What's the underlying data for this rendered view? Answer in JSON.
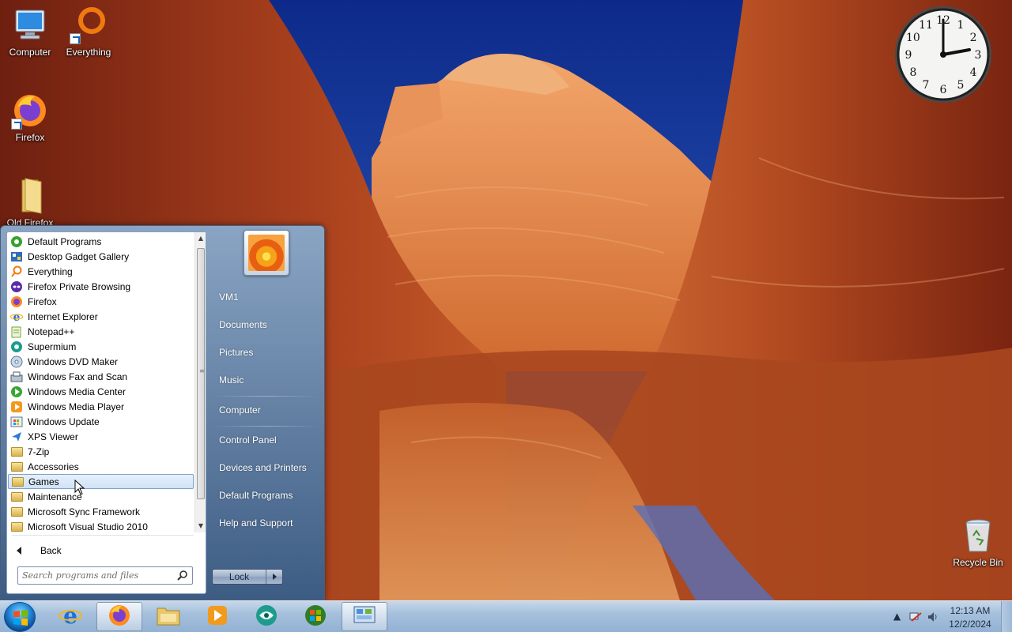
{
  "desktop": {
    "icons": [
      {
        "label": "Computer"
      },
      {
        "label": "Everything"
      },
      {
        "label": "Firefox"
      },
      {
        "label": "Old Firefox"
      },
      {
        "label": "Recycle Bin"
      }
    ]
  },
  "clock_gadget": {
    "numerals": [
      "12",
      "1",
      "2",
      "3",
      "4",
      "5",
      "6",
      "7",
      "8",
      "9",
      "10",
      "11"
    ]
  },
  "start_menu": {
    "programs": [
      {
        "label": "Default Programs",
        "icon": "default-programs-icon"
      },
      {
        "label": "Desktop Gadget Gallery",
        "icon": "gadget-gallery-icon"
      },
      {
        "label": "Everything",
        "icon": "everything-icon"
      },
      {
        "label": "Firefox Private Browsing",
        "icon": "firefox-private-icon"
      },
      {
        "label": "Firefox",
        "icon": "firefox-icon"
      },
      {
        "label": "Internet Explorer",
        "icon": "internet-explorer-icon"
      },
      {
        "label": "Notepad++",
        "icon": "notepad-plus-plus-icon"
      },
      {
        "label": "Supermium",
        "icon": "supermium-icon"
      },
      {
        "label": "Windows DVD Maker",
        "icon": "dvd-maker-icon"
      },
      {
        "label": "Windows Fax and Scan",
        "icon": "fax-scan-icon"
      },
      {
        "label": "Windows Media Center",
        "icon": "media-center-icon"
      },
      {
        "label": "Windows Media Player",
        "icon": "media-player-icon"
      },
      {
        "label": "Windows Update",
        "icon": "windows-update-icon"
      },
      {
        "label": "XPS Viewer",
        "icon": "xps-viewer-icon"
      },
      {
        "label": "7-Zip",
        "icon": "folder-icon"
      },
      {
        "label": "Accessories",
        "icon": "folder-icon"
      },
      {
        "label": "Games",
        "icon": "folder-icon",
        "selected": true
      },
      {
        "label": "Maintenance",
        "icon": "folder-icon"
      },
      {
        "label": "Microsoft Sync Framework",
        "icon": "folder-icon"
      },
      {
        "label": "Microsoft Visual Studio 2010",
        "icon": "folder-icon"
      }
    ],
    "back_label": "Back",
    "search_placeholder": "Search programs and files",
    "right_items": {
      "user": "VM1",
      "documents": "Documents",
      "pictures": "Pictures",
      "music": "Music",
      "computer": "Computer",
      "control_panel": "Control Panel",
      "devices_printers": "Devices and Printers",
      "default_programs": "Default Programs",
      "help_support": "Help and Support"
    },
    "lock_label": "Lock"
  },
  "taskbar": {
    "pinned": [
      {
        "name": "internet-explorer-taskbar-button",
        "icon": "internet-explorer-icon"
      },
      {
        "name": "firefox-taskbar-button",
        "icon": "firefox-icon",
        "active": true
      },
      {
        "name": "explorer-taskbar-button",
        "icon": "folder-icon"
      },
      {
        "name": "media-player-taskbar-button",
        "icon": "media-player-icon"
      },
      {
        "name": "supermium-taskbar-button",
        "icon": "supermium-icon"
      },
      {
        "name": "windows-update-taskbar-button",
        "icon": "windows-orb-icon"
      },
      {
        "name": "control-panel-taskbar-button",
        "icon": "control-panel-icon",
        "active": true
      }
    ],
    "clock": {
      "time": "12:13 AM",
      "date": "12/2/2024"
    }
  },
  "colors": {
    "taskbar": "#a6c0dc",
    "start_menu_frame": "#3d5c83",
    "selection": "#cfe2f7"
  }
}
